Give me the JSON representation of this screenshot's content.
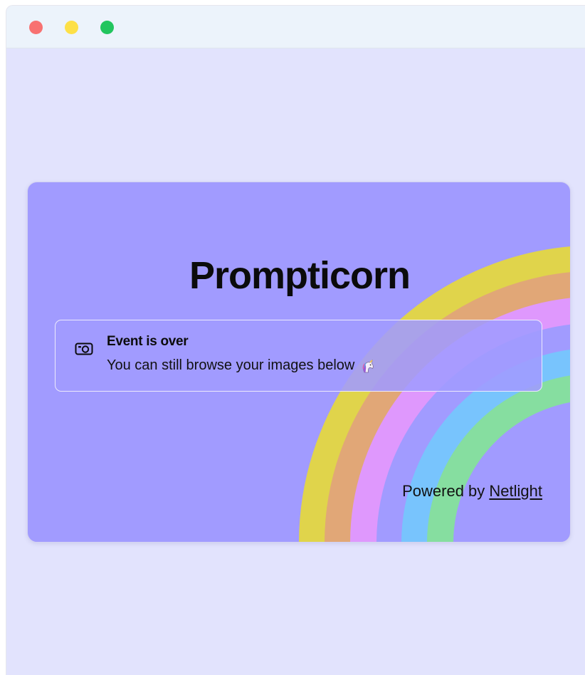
{
  "window": {
    "controls": [
      "close",
      "minimize",
      "maximize"
    ],
    "colors": {
      "close": "#f87171",
      "minimize": "#fde047",
      "maximize": "#22c55e"
    }
  },
  "card": {
    "title": "Prompticorn",
    "background": "#a19bff",
    "rainbow_colors": [
      "#e0d44b",
      "#e1a777",
      "#df98fd",
      "#78c4fd",
      "#86dea0"
    ]
  },
  "alert": {
    "icon": "camera-icon",
    "heading": "Event is over",
    "description": "You can still browse your images below",
    "emoji": "unicorn-icon"
  },
  "footer": {
    "powered_prefix": "Powered by ",
    "link_label": "Netlight"
  }
}
